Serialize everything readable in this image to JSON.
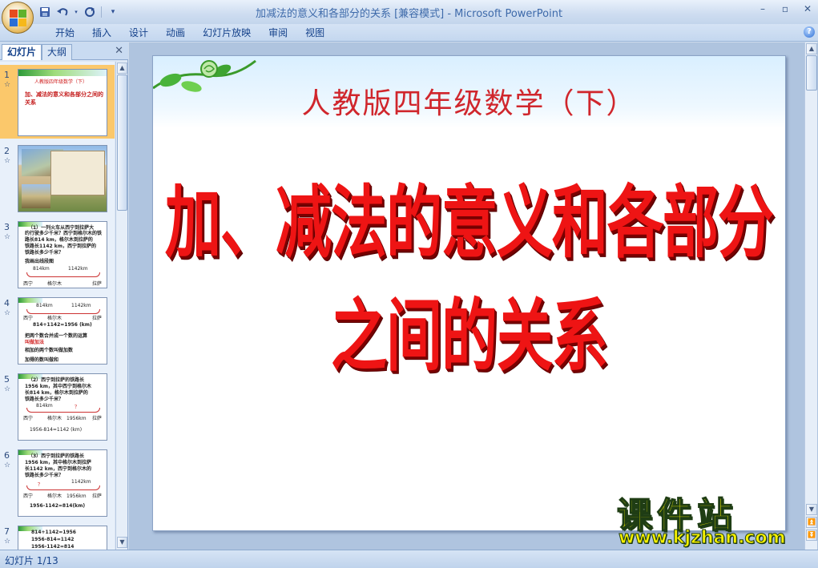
{
  "window": {
    "title": "加减法的意义和各部分的关系 [兼容模式] - Microsoft PowerPoint",
    "controls": [
      "–",
      "▫",
      "✕"
    ]
  },
  "quick_access": {
    "icons": [
      "save-icon",
      "undo-icon",
      "redo-icon",
      "customize-icon"
    ]
  },
  "ribbon": {
    "tabs": [
      "开始",
      "插入",
      "设计",
      "动画",
      "幻灯片放映",
      "审阅",
      "视图"
    ],
    "help": "?"
  },
  "left_panel": {
    "tab_slides": "幻灯片",
    "tab_outline": "大纲",
    "close": "✕",
    "thumbnails": [
      {
        "number": "1",
        "lines": [
          "人教版四年级数学（下）",
          "加、减法的意义和各部分之间的关系"
        ]
      },
      {
        "number": "2",
        "lines": []
      },
      {
        "number": "3",
        "lines": [
          "（1）一列火车从西宁到拉萨大",
          "约行驶多少千米？西宁到格尔木的铁",
          "路长814 km，格尔木到拉萨的",
          "铁路长1142 km，西宁到拉萨的",
          "铁路长多少千米？",
          "我画出线段图",
          "814km",
          "1142km",
          "西宁",
          "格尔木",
          "拉萨"
        ]
      },
      {
        "number": "4",
        "lines": [
          "814km",
          "1142km",
          "西宁",
          "格尔木",
          "拉萨",
          "814+1142=1956 (km)",
          "把两个数合并成一个数的运算",
          "叫做加法",
          "相加的两个数叫做加数",
          "加得的数叫做和"
        ]
      },
      {
        "number": "5",
        "lines": [
          "（2）西宁到拉萨的铁路长",
          "1956 km，其中西宁到格尔木",
          "长814 km，格尔木到拉萨的",
          "铁路长多少千米？",
          "814km",
          "？",
          "西宁",
          "格尔木",
          "1956km",
          "拉萨",
          "1956-814=1142 (km)"
        ]
      },
      {
        "number": "6",
        "lines": [
          "（3）西宁到拉萨的铁路长",
          "1956 km，其中格尔木到拉萨",
          "长1142 km，西宁到格尔木的",
          "铁路长多少千米？",
          "？",
          "1142km",
          "西宁",
          "格尔木",
          "1956km",
          "拉萨",
          "1956-1142=814(km)"
        ]
      },
      {
        "number": "7",
        "lines": [
          "814+1142=1956",
          "1956-814=1142",
          "1956-1142=814"
        ]
      }
    ]
  },
  "slide": {
    "subtitle": "人教版四年级数学（下）",
    "title": "加、减法的意义和各部分之间的关系"
  },
  "watermark": {
    "cn": "课件站",
    "url": "www.kjzhan.com"
  },
  "status": {
    "slide_indicator": "幻灯片 1/13"
  },
  "colors": {
    "title_red": "#ee1414",
    "selected_thumb": "#fbc86b",
    "watermark_yellow": "#f6f000"
  }
}
